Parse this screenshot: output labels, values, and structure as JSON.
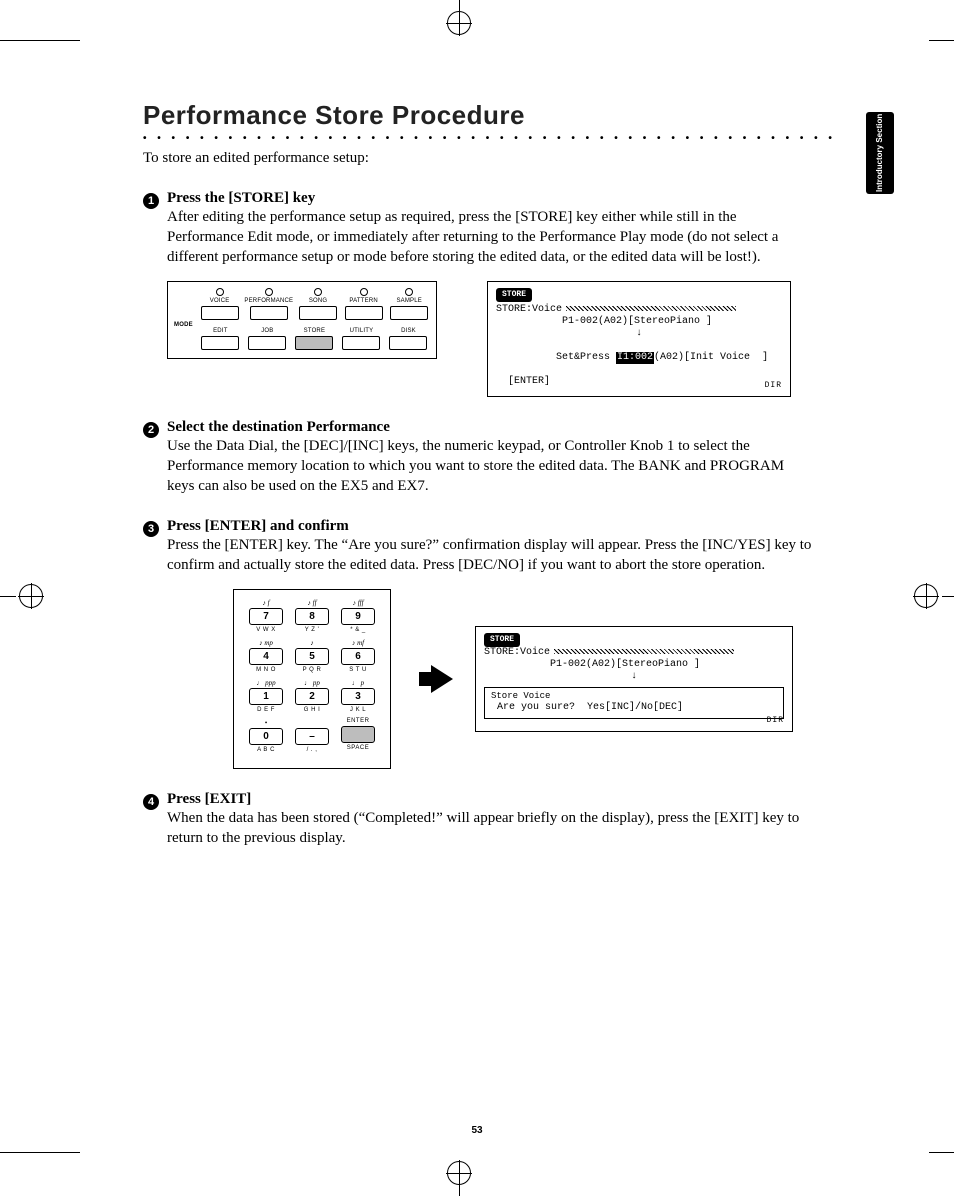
{
  "side_tab": "Introductory Section",
  "page_number": "53",
  "title": "Performance Store Procedure",
  "intro": "To store an edited performance setup:",
  "steps": {
    "1": {
      "num": "1",
      "title": "Press the [STORE] key",
      "body": "After editing the performance setup as required, press the [STORE] key either while still in the Performance Edit mode, or immediately after returning to the Performance Play mode (do not select a different performance setup or mode before storing the edited data, or the edited data will be lost!)."
    },
    "2": {
      "num": "2",
      "title": "Select the destination Performance",
      "body": "Use the Data Dial, the [DEC]/[INC] keys, the numeric keypad, or Controller Knob 1 to select the Performance memory location to which you want to store the edited data. The BANK and PROGRAM keys can also be used on the EX5 and EX7."
    },
    "3": {
      "num": "3",
      "title": "Press [ENTER] and confirm",
      "body": "Press the [ENTER] key. The “Are you sure?” confirmation display will appear. Press the [INC/YES] key to confirm and actually store the edited data. Press [DEC/NO] if you want to abort the store operation."
    },
    "4": {
      "num": "4",
      "title": "Press [EXIT]",
      "body": "When the data has been stored (“Completed!” will appear briefly on the display), press the [EXIT] key to return to the previous display."
    }
  },
  "mode_panel": {
    "mode_label": "MODE",
    "row1": [
      "VOICE",
      "PERFORMANCE",
      "SONG",
      "PATTERN",
      "SAMPLE"
    ],
    "row2": [
      "EDIT",
      "JOB",
      "STORE",
      "UTILITY",
      "DISK"
    ]
  },
  "lcd1": {
    "tab": "STORE",
    "line1": "STORE:Voice",
    "line2": "           P1-002(A02)[StereoPiano ]",
    "line3_left": "Set&Press ",
    "line3_sel": "I1:002",
    "line3_right": "(A02)[Init Voice  ]",
    "line4": "  [ENTER]",
    "dir": "DIR"
  },
  "keypad": {
    "rows": [
      [
        {
          "dyn": "♪ f",
          "key": "7",
          "sub": "V W X"
        },
        {
          "dyn": "♪ ff",
          "key": "8",
          "sub": "Y Z '"
        },
        {
          "dyn": "♪ fff",
          "key": "9",
          "sub": "* & _"
        }
      ],
      [
        {
          "dyn": "♪ mp",
          "key": "4",
          "sub": "M N O"
        },
        {
          "dyn": "♪",
          "key": "5",
          "sub": "P Q R"
        },
        {
          "dyn": "♪ mf",
          "key": "6",
          "sub": "S T U"
        }
      ],
      [
        {
          "dyn": "♩ ppp",
          "key": "1",
          "sub": "D E F"
        },
        {
          "dyn": "♩ pp",
          "key": "2",
          "sub": "G H I"
        },
        {
          "dyn": "♩ p",
          "key": "3",
          "sub": "J K L"
        }
      ]
    ],
    "bottom": {
      "zero": {
        "dyn": "•",
        "key": "0",
        "sub": "A B C"
      },
      "dash": {
        "key": "–",
        "sub": "/ . ,"
      },
      "enter": {
        "label": "ENTER",
        "sub": "SPACE"
      }
    }
  },
  "lcd2": {
    "tab": "STORE",
    "line1": "STORE:Voice",
    "line2": "           P1-002(A02)[StereoPiano ]",
    "box_title": "Store Voice",
    "box_text": " Are you sure?  Yes[INC]/No[DEC]",
    "dir": "DIR"
  }
}
